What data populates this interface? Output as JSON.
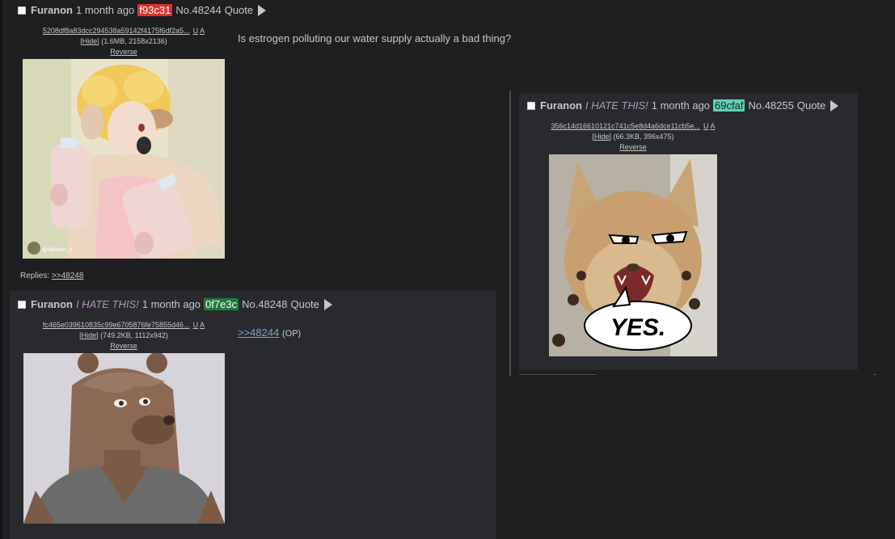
{
  "posts": [
    {
      "name": "Furanon",
      "time": "1 month ago",
      "uid": "f93c31",
      "uid_bg": "#d9322f",
      "uid_fg": "#ffffff",
      "no": "No.48244",
      "quote": "Quote",
      "file_hash": "5208df8a83dcc294538a59142f4175f6df2a5...",
      "u": "U",
      "a": "A",
      "hide": "Hide",
      "file_meta": " (1.6MB, 2158x2136)",
      "reverse": "Reverse",
      "message": "Is estrogen polluting our water supply actually a bad thing?",
      "replies_label": "Replies:",
      "reply_link": ">>48248",
      "watermark": "@dalkorn_k"
    },
    {
      "name": "Furanon",
      "subject": "I HATE THIS!",
      "time": "1 month ago",
      "uid": "0f7e3c",
      "uid_bg": "#1f7a3a",
      "uid_fg": "#ffffff",
      "no": "No.48248",
      "quote": "Quote",
      "file_hash": "fc465e039610835c99e6705876fe75855d46...",
      "u": "U",
      "a": "A",
      "hide": "Hide",
      "file_meta": " (749.2KB, 1112x942)",
      "reverse": "Reverse",
      "quote_link": ">>48244",
      "op_tag": "(OP)"
    },
    {
      "name": "Furanon",
      "subject": "I HATE THIS!",
      "time": "1 month ago",
      "uid": "69cfaf",
      "uid_bg": "#5ed1b8",
      "uid_fg": "#1d1f21",
      "no": "No.48255",
      "quote": "Quote",
      "file_hash": "356c14d16610121c741c5e8d4a6dce11cb5e...",
      "u": "U",
      "a": "A",
      "hide": "Hide",
      "file_meta": " (66.3KB, 396x475)",
      "reverse": "Reverse",
      "image_caption": "YES."
    }
  ],
  "colors": {
    "background": "#1d1f21",
    "reply_bg": "#282a2e",
    "text": "#c5c8c6",
    "subject": "#b294bb",
    "link": "#81a2be"
  }
}
